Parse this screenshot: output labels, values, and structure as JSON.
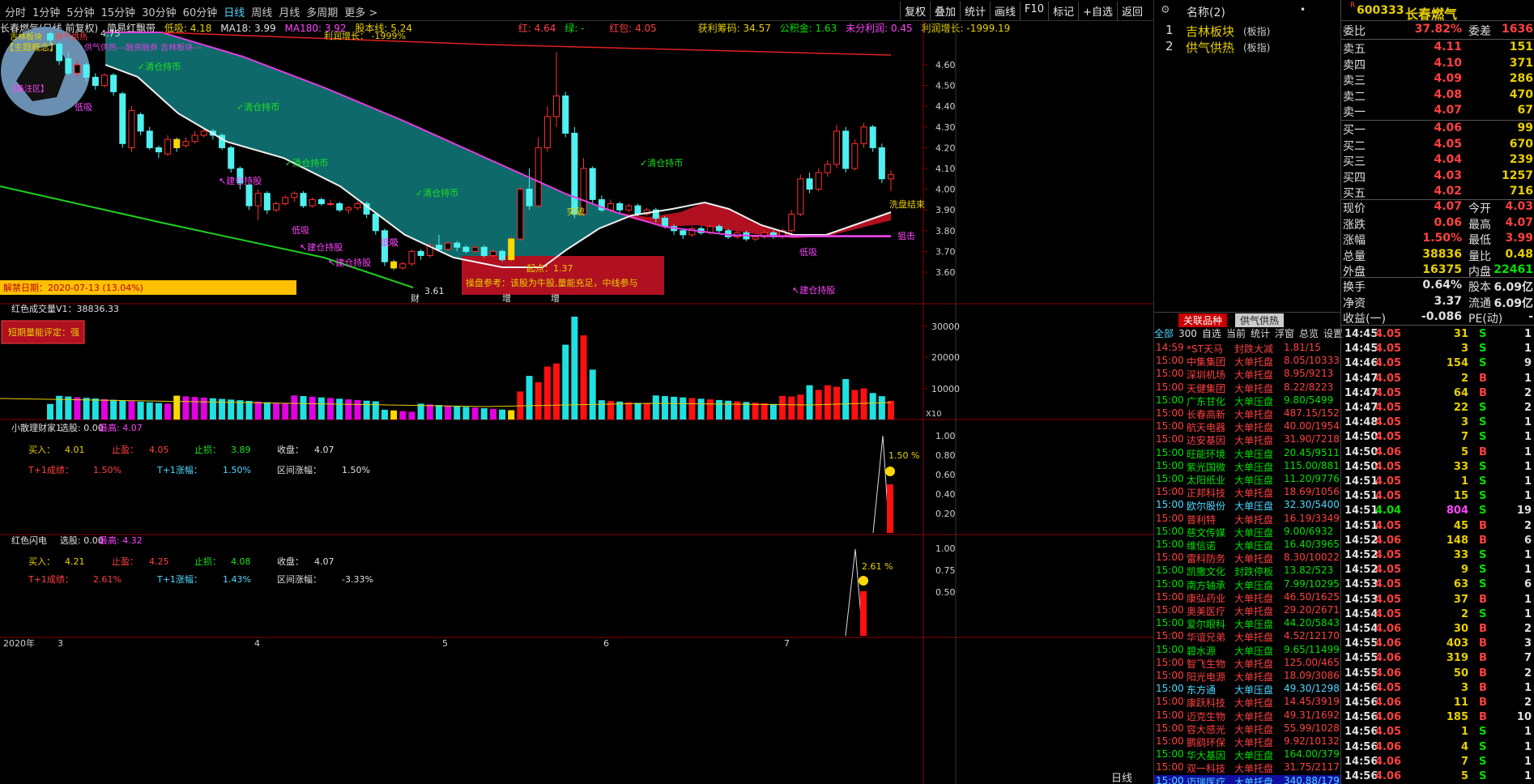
{
  "toolbar": {
    "periods": [
      "分时",
      "1分钟",
      "5分钟",
      "15分钟",
      "30分钟",
      "60分钟",
      "日线",
      "周线",
      "月线",
      "多周期",
      "更多 >"
    ],
    "active_period": "日线",
    "buttons": [
      "复权",
      "叠加",
      "统计",
      "画线",
      "F10",
      "标记",
      "+自选",
      "返回"
    ]
  },
  "info_line": {
    "title": "长春燃气(日线 前复权)",
    "indicator": "简易红飘带",
    "low": "低吸: 4.18",
    "ma18": "MA18: 3.99",
    "ma180": "MA180: 3.92",
    "share_line": "股本线: 5.24",
    "red": "红: 4.64",
    "green": "绿: -",
    "red_pack": "红包: 4.05",
    "profit_chip": "获利筹码: 34.57",
    "reserve": "公积金: 1.63",
    "undist": "未分利润: 0.45",
    "profit_growth": "利润增长: -1999.19"
  },
  "main_chart": {
    "yticks": [
      "4.60",
      "4.50",
      "4.40",
      "4.30",
      "4.20",
      "4.10",
      "4.00",
      "3.90",
      "3.80",
      "3.70",
      "3.60"
    ],
    "max_price_label": "4.75",
    "min_price_label": "3.61",
    "profit_growth_label": "利润增长：  -1999%",
    "concept_box": "【主题概念】",
    "concept_text": "供气供热---融资融券 吉林板块---",
    "avatar_tags": [
      "吉林板块",
      "供气供热"
    ],
    "remark_tag": "【备注区】",
    "signals": [
      {
        "t": "✓清仓持币",
        "k": "clear"
      },
      {
        "t": "✓清仓持币",
        "k": "clear"
      },
      {
        "t": "✓清仓持币",
        "k": "clear"
      },
      {
        "t": "✓清仓持币",
        "k": "clear"
      },
      {
        "t": "✓清仓持币",
        "k": "clear"
      },
      {
        "t": "↖建仓持股",
        "k": "build"
      },
      {
        "t": "↖建仓持股",
        "k": "build"
      },
      {
        "t": "↖建仓持股",
        "k": "build"
      },
      {
        "t": "↖建仓持股",
        "k": "build"
      },
      {
        "t": "低吸",
        "k": "low"
      },
      {
        "t": "低吸",
        "k": "low"
      },
      {
        "t": "低吸",
        "k": "low"
      },
      {
        "t": "低吸",
        "k": "low"
      },
      {
        "t": "低吸",
        "k": "low"
      }
    ],
    "wash_end": "洗盘结束",
    "sniper": "狙击",
    "breakout": "突破",
    "lift_label": "起点：1.37",
    "lift_ref": "操盘参考：该股为牛股,量能充足，中线参与",
    "ban_date": "解禁日期：2020-07-13 (13.04%)",
    "markers": [
      "财",
      "增",
      "增"
    ]
  },
  "volume_panel": {
    "title": "红色成交量V1：38836.33",
    "badge": "短期量能评定：强",
    "yticks": [
      "30000",
      "20000",
      "10000"
    ],
    "unit": "X10"
  },
  "panel3": {
    "title": "小散理财家1",
    "pick": "选股: 0.00",
    "highest": "最高: 4.07",
    "buy_lbl": "买入：",
    "buy": "4.01",
    "tp_lbl": "止盈：",
    "tp": "4.05",
    "sl_lbl": "止损：",
    "sl": "3.89",
    "close_lbl": "收盘：",
    "close": "4.07",
    "t1_lbl": "T+1成绩：",
    "t1": "1.50%",
    "t1u_lbl": "T+1涨幅：",
    "t1u": "1.50%",
    "range_lbl": "区间涨幅：",
    "range": "1.50%",
    "yticks": [
      "1.00",
      "0.80",
      "0.60",
      "0.40",
      "0.20"
    ],
    "peak_label": "1.50 %"
  },
  "panel4": {
    "title": "红色闪电",
    "pick": "选股: 0.00",
    "highest": "最高: 4.32",
    "buy_lbl": "买入：",
    "buy": "4.21",
    "tp_lbl": "止盈：",
    "tp": "4.25",
    "sl_lbl": "止损：",
    "sl": "4.08",
    "close_lbl": "收盘：",
    "close": "4.07",
    "t1_lbl": "T+1成绩：",
    "t1": "2.61%",
    "t1u_lbl": "T+1涨幅：",
    "t1u": "1.43%",
    "range_lbl": "区间涨幅：",
    "range": "-3.33%",
    "yticks": [
      "1.00",
      "0.75",
      "0.50"
    ],
    "peak_label": "2.61 %"
  },
  "xaxis": {
    "labels": [
      "2020年",
      "3",
      "4",
      "5",
      "6",
      "7"
    ],
    "period": "日线"
  },
  "sector": {
    "header": "名称(2)",
    "items": [
      {
        "n": "1",
        "name": "吉林板块",
        "tag": "(板指)"
      },
      {
        "n": "2",
        "name": "供气供热",
        "tag": "(板指)"
      }
    ],
    "tabs": [
      "关联品种",
      "供气供热"
    ],
    "filters": [
      "全部",
      "300",
      "自选",
      "当前",
      "统计",
      "浮窗",
      "总览",
      "设置"
    ]
  },
  "news": [
    [
      "14:59",
      "*ST天马",
      "封跌大减",
      "1.81/15",
      "r"
    ],
    [
      "15:00",
      "中集集团",
      "大单托盘",
      "8.05/10333",
      "r"
    ],
    [
      "15:00",
      "深圳机场",
      "大单托盘",
      "8.95/9213",
      "r"
    ],
    [
      "15:00",
      "天健集团",
      "大单托盘",
      "8.22/8223",
      "r"
    ],
    [
      "15:00",
      "广东甘化",
      "大单压盘",
      "9.80/5499",
      "g"
    ],
    [
      "15:00",
      "长春高新",
      "大单托盘",
      "487.15/152",
      "r"
    ],
    [
      "15:00",
      "航天电器",
      "大单托盘",
      "40.00/1954",
      "r"
    ],
    [
      "15:00",
      "达安基因",
      "大单托盘",
      "31.90/7218",
      "r"
    ],
    [
      "15:00",
      "旺能环境",
      "大单压盘",
      "20.45/9511",
      "g"
    ],
    [
      "15:00",
      "紫光国微",
      "大单压盘",
      "115.00/881",
      "g"
    ],
    [
      "15:00",
      "太阳纸业",
      "大单压盘",
      "11.20/9776",
      "g"
    ],
    [
      "15:00",
      "正邦科技",
      "大单托盘",
      "18.69/10569",
      "r"
    ],
    [
      "15:00",
      "欧尔股份",
      "大单压盘",
      "32.30/5400",
      "c"
    ],
    [
      "15:00",
      "普利特",
      "大单托盘",
      "16.19/3349",
      "r"
    ],
    [
      "15:00",
      "慈文传媒",
      "大单压盘",
      "9.00/6932",
      "g"
    ],
    [
      "15:00",
      "维信诺",
      "大单压盘",
      "16.40/3965",
      "g"
    ],
    [
      "15:00",
      "雷科防务",
      "大单托盘",
      "8.30/10022",
      "r"
    ],
    [
      "15:00",
      "凯撒文化",
      "封跌停板",
      "13.82/523",
      "g"
    ],
    [
      "15:00",
      "南方轴承",
      "大单压盘",
      "7.99/10295",
      "g"
    ],
    [
      "15:00",
      "康弘药业",
      "大单托盘",
      "46.50/1625",
      "r"
    ],
    [
      "15:00",
      "奥美医疗",
      "大单托盘",
      "29.20/2671",
      "r"
    ],
    [
      "15:00",
      "爱尔眼科",
      "大单压盘",
      "44.20/5843",
      "g"
    ],
    [
      "15:00",
      "华谊兄弟",
      "大单托盘",
      "4.52/12170",
      "r"
    ],
    [
      "15:00",
      "碧水源",
      "大单压盘",
      "9.65/11499",
      "g"
    ],
    [
      "15:00",
      "智飞生物",
      "大单托盘",
      "125.00/465",
      "r"
    ],
    [
      "15:00",
      "阳光电源",
      "大单托盘",
      "18.09/3086",
      "r"
    ],
    [
      "15:00",
      "东方通",
      "大单压盘",
      "49.30/1298",
      "c"
    ],
    [
      "15:00",
      "康跃科技",
      "大单托盘",
      "14.45/3919",
      "r"
    ],
    [
      "15:00",
      "迈克生物",
      "大单托盘",
      "49.31/1692",
      "r"
    ],
    [
      "15:00",
      "容大感光",
      "大单托盘",
      "55.99/1028",
      "r"
    ],
    [
      "15:00",
      "鹏鹞环保",
      "大单托盘",
      "9.92/10132",
      "r"
    ],
    [
      "15:00",
      "华大基因",
      "大单压盘",
      "164.00/379",
      "g"
    ],
    [
      "15:00",
      "双一科技",
      "大单托盘",
      "31.75/2117",
      "r"
    ],
    [
      "15:00",
      "迈瑞医疗",
      "大单托盘",
      "340.88/179",
      "c"
    ]
  ],
  "quote": {
    "code": "600333",
    "name": "长春燃气",
    "r_badge": "R",
    "ratio_lbl": "委比",
    "ratio": "37.82%",
    "diff_lbl": "委差",
    "diff": "1636",
    "asks": [
      [
        "卖五",
        "4.11",
        "151"
      ],
      [
        "卖四",
        "4.10",
        "371"
      ],
      [
        "卖三",
        "4.09",
        "286"
      ],
      [
        "卖二",
        "4.08",
        "470"
      ],
      [
        "卖一",
        "4.07",
        "67"
      ]
    ],
    "bids": [
      [
        "买一",
        "4.06",
        "99"
      ],
      [
        "买二",
        "4.05",
        "670"
      ],
      [
        "买三",
        "4.04",
        "239"
      ],
      [
        "买四",
        "4.03",
        "1257"
      ],
      [
        "买五",
        "4.02",
        "716"
      ]
    ],
    "stats": [
      [
        "现价",
        "4.07",
        "今开",
        "4.03"
      ],
      [
        "涨跌",
        "0.06",
        "最高",
        "4.07"
      ],
      [
        "涨幅",
        "1.50%",
        "最低",
        "3.99"
      ],
      [
        "总量",
        "38836",
        "量比",
        "0.48"
      ],
      [
        "外盘",
        "16375",
        "内盘",
        "22461"
      ]
    ],
    "stats2": [
      [
        "换手",
        "0.64%",
        "股本",
        "6.09亿"
      ],
      [
        "净资",
        "3.37",
        "流通",
        "6.09亿"
      ],
      [
        "收益(一)",
        "-0.086",
        "PE(动)",
        "-"
      ]
    ]
  },
  "trades": [
    [
      "14:45",
      "4.05",
      "31",
      "S",
      "1"
    ],
    [
      "14:45",
      "4.05",
      "3",
      "S",
      "1"
    ],
    [
      "14:46",
      "4.05",
      "154",
      "S",
      "9"
    ],
    [
      "14:47",
      "4.05",
      "2",
      "B",
      "1"
    ],
    [
      "14:47",
      "4.05",
      "64",
      "B",
      "2"
    ],
    [
      "14:47",
      "4.05",
      "22",
      "S",
      "2"
    ],
    [
      "14:48",
      "4.05",
      "3",
      "S",
      "1"
    ],
    [
      "14:50",
      "4.05",
      "7",
      "S",
      "1"
    ],
    [
      "14:50",
      "4.06",
      "5",
      "B",
      "1"
    ],
    [
      "14:50",
      "4.05",
      "33",
      "S",
      "1"
    ],
    [
      "14:51",
      "4.05",
      "1",
      "S",
      "1"
    ],
    [
      "14:51",
      "4.05",
      "15",
      "S",
      "1"
    ],
    [
      "14:51",
      "4.04",
      "804",
      "S",
      "19"
    ],
    [
      "14:51",
      "4.05",
      "45",
      "B",
      "2"
    ],
    [
      "14:52",
      "4.06",
      "148",
      "B",
      "6"
    ],
    [
      "14:52",
      "4.05",
      "33",
      "S",
      "1"
    ],
    [
      "14:52",
      "4.05",
      "9",
      "S",
      "1"
    ],
    [
      "14:53",
      "4.05",
      "63",
      "S",
      "6"
    ],
    [
      "14:53",
      "4.05",
      "37",
      "B",
      "1"
    ],
    [
      "14:54",
      "4.05",
      "2",
      "S",
      "1"
    ],
    [
      "14:54",
      "4.06",
      "30",
      "B",
      "2"
    ],
    [
      "14:55",
      "4.06",
      "403",
      "B",
      "3"
    ],
    [
      "14:55",
      "4.06",
      "319",
      "B",
      "7"
    ],
    [
      "14:55",
      "4.06",
      "50",
      "B",
      "2"
    ],
    [
      "14:56",
      "4.05",
      "3",
      "B",
      "1"
    ],
    [
      "14:56",
      "4.06",
      "11",
      "B",
      "2"
    ],
    [
      "14:56",
      "4.06",
      "185",
      "B",
      "10"
    ],
    [
      "14:56",
      "4.05",
      "1",
      "S",
      "1"
    ],
    [
      "14:56",
      "4.06",
      "4",
      "S",
      "1"
    ],
    [
      "14:56",
      "4.06",
      "7",
      "S",
      "1"
    ],
    [
      "14:56",
      "4.06",
      "5",
      "S",
      "1"
    ]
  ]
}
